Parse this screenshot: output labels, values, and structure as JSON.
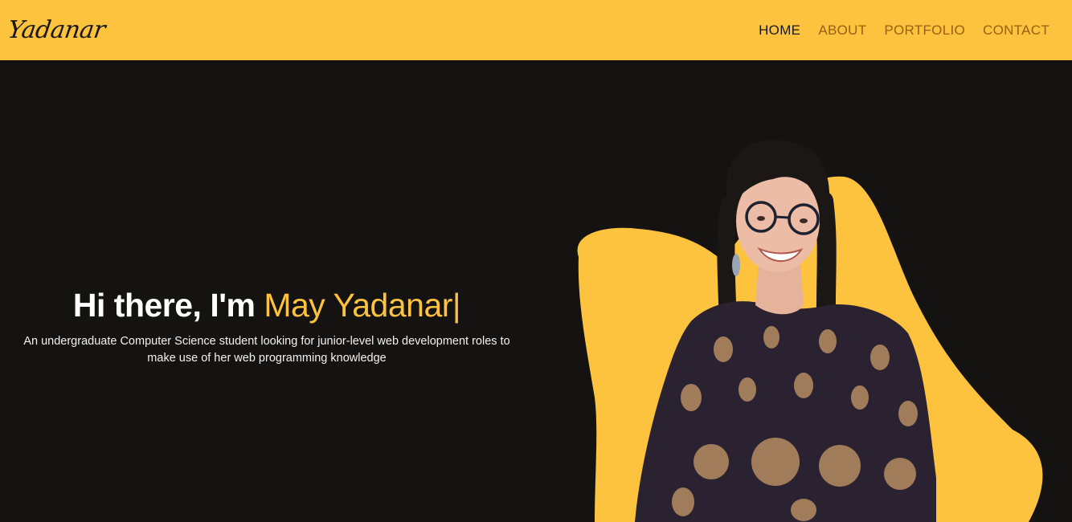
{
  "logo": {
    "text": "Yadanar"
  },
  "nav": {
    "items": [
      {
        "label": "HOME",
        "active": true
      },
      {
        "label": "ABOUT",
        "active": false
      },
      {
        "label": "PORTFOLIO",
        "active": false
      },
      {
        "label": "CONTACT",
        "active": false
      }
    ]
  },
  "hero": {
    "greeting": "Hi there, I'm",
    "name": "May Yadanar",
    "cursor": "|",
    "tagline": "An undergraduate Computer Science student looking for junior-level web development roles to make use of her web programming knowledge"
  },
  "colors": {
    "accent": "#fdc33f",
    "background": "#141312",
    "nav_link": "#9c5e12",
    "nav_active": "#1c1a16"
  }
}
